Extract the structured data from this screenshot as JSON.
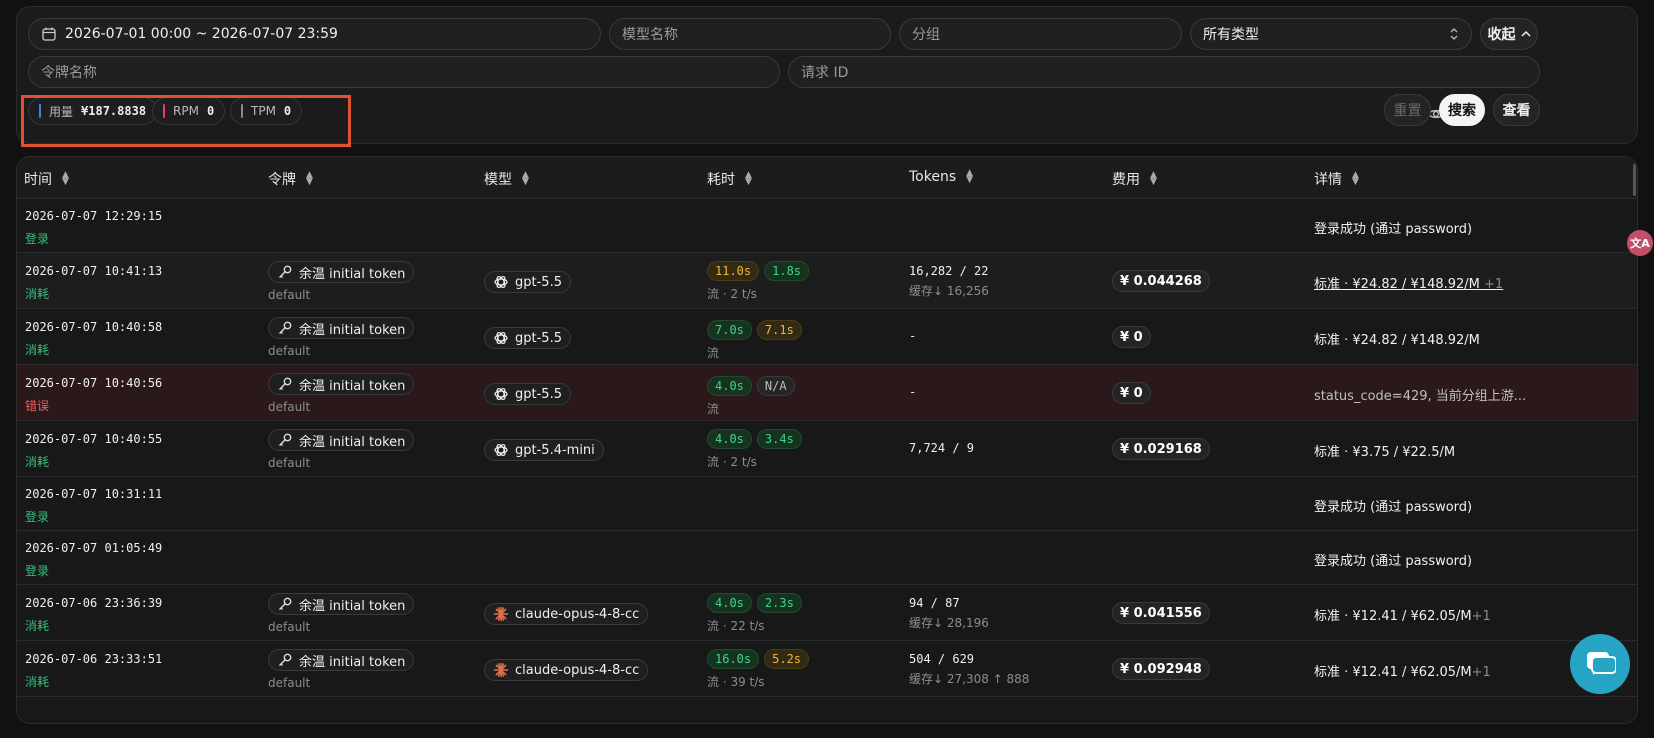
{
  "filters": {
    "date_range": "2026-07-01 00:00 ~ 2026-07-07 23:59",
    "model_placeholder": "模型名称",
    "group_placeholder": "分组",
    "type_value": "所有类型",
    "collapse_label": "收起",
    "token_placeholder": "令牌名称",
    "request_id_placeholder": "请求 ID"
  },
  "stats": {
    "usage_label": "用量",
    "usage_value": "¥187.8838",
    "rpm_label": "RPM",
    "rpm_value": "0",
    "tpm_label": "TPM",
    "tpm_value": "0",
    "colors": {
      "usage": "#3b82f6",
      "rpm": "#e0406a",
      "tpm": "#888888"
    }
  },
  "actions": {
    "reset_label": "重置",
    "search_label": "搜索",
    "view_label": "查看"
  },
  "table": {
    "headers": {
      "time": "时间",
      "token": "令牌",
      "model": "模型",
      "duration": "耗时",
      "tokens": "Tokens",
      "cost": "费用",
      "detail": "详情"
    },
    "rows": [
      {
        "time": "2026-07-07 12:29:15",
        "type": "登录",
        "detail": "登录成功 (通过 password)"
      },
      {
        "time": "2026-07-07 10:41:13",
        "type": "消耗",
        "token": "余温 initial token",
        "group": "default",
        "model": "gpt-5.5",
        "d1": "11.0s",
        "d2": "1.8s",
        "stream": "流 · 2 t/s",
        "tokens": "16,282 / 22",
        "cache": "缓存↓ 16,256",
        "cost": "¥ 0.044268",
        "detail": "标准 · ¥24.82 / ¥148.92/M",
        "detail_plus": "+1"
      },
      {
        "time": "2026-07-07 10:40:58",
        "type": "消耗",
        "token": "余温 initial token",
        "group": "default",
        "model": "gpt-5.5",
        "d1": "7.0s",
        "d2": "7.1s",
        "stream": "流",
        "tokens": "-",
        "cost": "¥ 0",
        "detail": "标准 · ¥24.82 / ¥148.92/M"
      },
      {
        "time": "2026-07-07 10:40:56",
        "type": "错误",
        "token": "余温 initial token",
        "group": "default",
        "model": "gpt-5.5",
        "d1": "4.0s",
        "d2": "N/A",
        "stream": "流",
        "tokens": "-",
        "cost": "¥ 0",
        "detail": "status_code=429, 当前分组上游..."
      },
      {
        "time": "2026-07-07 10:40:55",
        "type": "消耗",
        "token": "余温 initial token",
        "group": "default",
        "model": "gpt-5.4-mini",
        "d1": "4.0s",
        "d2": "3.4s",
        "stream": "流 · 2 t/s",
        "tokens": "7,724 / 9",
        "cost": "¥ 0.029168",
        "detail": "标准 · ¥3.75 / ¥22.5/M"
      },
      {
        "time": "2026-07-07 10:31:11",
        "type": "登录",
        "detail": "登录成功 (通过 password)"
      },
      {
        "time": "2026-07-07 01:05:49",
        "type": "登录",
        "detail": "登录成功 (通过 password)"
      },
      {
        "time": "2026-07-06 23:36:39",
        "type": "消耗",
        "token": "余温 initial token",
        "group": "default",
        "model": "claude-opus-4-8-cc",
        "d1": "4.0s",
        "d2": "2.3s",
        "stream": "流 · 22 t/s",
        "tokens": "94 / 87",
        "cache": "缓存↓ 28,196",
        "cost": "¥ 0.041556",
        "detail": "标准 · ¥12.41 / ¥62.05/M",
        "detail_plus": "+1"
      },
      {
        "time": "2026-07-06 23:33:51",
        "type": "消耗",
        "token": "余温 initial token",
        "group": "default",
        "model": "claude-opus-4-8-cc",
        "d1": "16.0s",
        "d2": "5.2s",
        "stream": "流 · 39 t/s",
        "tokens": "504 / 629",
        "cache": "缓存↓ 27,308 ↑ 888",
        "cost": "¥ 0.092948",
        "detail": "标准 · ¥12.41 / ¥62.05/M",
        "detail_plus": "+1"
      }
    ]
  },
  "fab": {
    "translate": "文A"
  }
}
